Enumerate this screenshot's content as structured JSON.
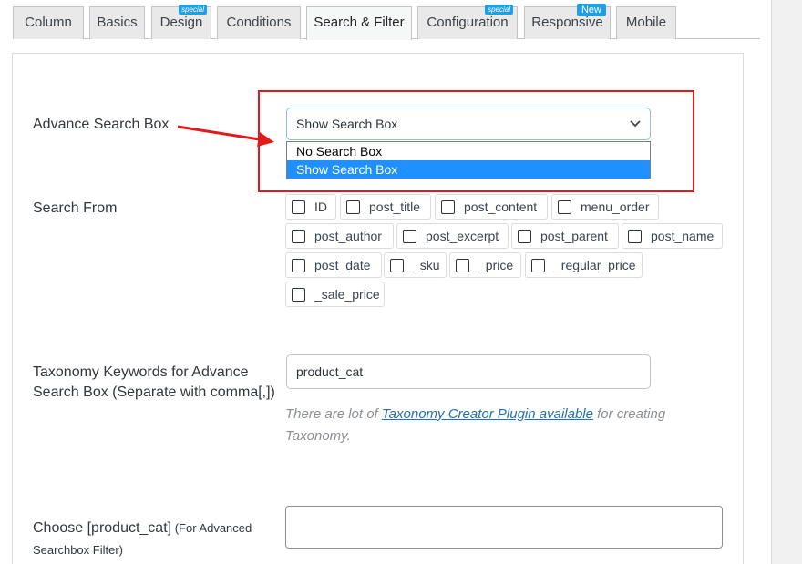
{
  "tabs": [
    {
      "label": "Column",
      "badge": ""
    },
    {
      "label": "Basics",
      "badge": ""
    },
    {
      "label": "Design",
      "badge": "special"
    },
    {
      "label": "Conditions",
      "badge": ""
    },
    {
      "label": "Search & Filter",
      "badge": ""
    },
    {
      "label": "Configuration",
      "badge": "special"
    },
    {
      "label": "Responsive",
      "badge": "New"
    },
    {
      "label": "Mobile",
      "badge": ""
    }
  ],
  "active_tab": "Search & Filter",
  "advance_search": {
    "label": "Advance Search Box",
    "selected": "Show Search Box",
    "options": [
      "No Search Box",
      "Show Search Box"
    ]
  },
  "search_from": {
    "label": "Search From",
    "fields": [
      "ID",
      "post_title",
      "post_content",
      "menu_order",
      "post_author",
      "post_excerpt",
      "post_parent",
      "post_name",
      "post_date",
      "_sku",
      "_price",
      "_regular_price",
      "_sale_price"
    ]
  },
  "taxonomy": {
    "label_line1": "Taxonomy Keywords for Advance",
    "label_line2": "Search Box (Separate with comma[,])",
    "value": "product_cat",
    "help_prefix": "There are lot of ",
    "help_link": "Taxonomy Creator Plugin available",
    "help_suffix": " for creating",
    "help_line2": "Taxonomy."
  },
  "choose": {
    "label_main": "Choose [product_cat]",
    "label_small": " (For Advanced",
    "label_line2": "Searchbox Filter)",
    "value": ""
  },
  "colors": {
    "highlight": "#e21a1a",
    "selected_option": "#1e90ff",
    "badge": "#1fa0e6",
    "link": "#2271b1"
  }
}
